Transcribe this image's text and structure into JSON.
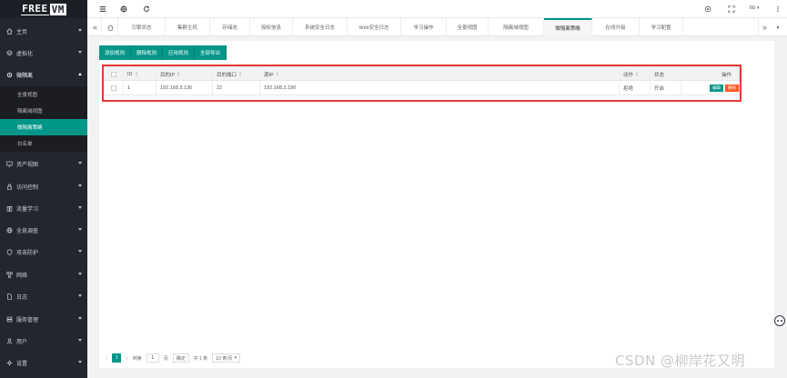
{
  "app": {
    "logo_part1": "FREE",
    "logo_part2": "VM"
  },
  "sidebar": {
    "items": [
      {
        "label": "主页",
        "icon": "home-icon"
      },
      {
        "label": "虚拟化",
        "icon": "layers-icon"
      },
      {
        "label": "微隔离",
        "icon": "gear-icon",
        "open": true
      },
      {
        "label": "资产视图",
        "icon": "monitor-icon"
      },
      {
        "label": "访问控制",
        "icon": "lock-icon"
      },
      {
        "label": "流量学习",
        "icon": "book-icon"
      },
      {
        "label": "全息调查",
        "icon": "globe-icon"
      },
      {
        "label": "攻击防护",
        "icon": "shield-icon"
      },
      {
        "label": "网络",
        "icon": "network-icon"
      },
      {
        "label": "日志",
        "icon": "file-icon"
      },
      {
        "label": "服务管理",
        "icon": "server-icon"
      },
      {
        "label": "用户",
        "icon": "user-icon"
      },
      {
        "label": "设置",
        "icon": "settings-icon"
      }
    ],
    "sub_items": [
      {
        "label": "全景视图",
        "active": false
      },
      {
        "label": "隔离域视图",
        "active": false
      },
      {
        "label": "微隔离策略",
        "active": true
      },
      {
        "label": "白名单",
        "active": false
      }
    ]
  },
  "topbar": {
    "user": "ito"
  },
  "tabs": [
    {
      "label": "引擎状态"
    },
    {
      "label": "集群主机"
    },
    {
      "label": "存储池"
    },
    {
      "label": "授权信息"
    },
    {
      "label": "系统安全日志"
    },
    {
      "label": "Web安全日志"
    },
    {
      "label": "学习操作"
    },
    {
      "label": "全景视图"
    },
    {
      "label": "隔离域视图"
    },
    {
      "label": "微隔离策略",
      "active": true
    },
    {
      "label": "在线升级"
    },
    {
      "label": "学习配置"
    }
  ],
  "toolbar": {
    "add_label": "添加规则",
    "delete_label": "删除规则",
    "apply_label": "应用规则",
    "export_label": "全部导出"
  },
  "table": {
    "columns": [
      "ID",
      "目的IP",
      "目的端口",
      "源IP",
      "动作",
      "状态",
      "操作"
    ],
    "rows": [
      {
        "id": "1",
        "dst_ip": "192.168.3.136",
        "dst_port": "22",
        "src_ip": "192.168.3.190",
        "action": "拒绝",
        "status": "开启",
        "edit_label": "编辑",
        "delete_label": "删除"
      }
    ]
  },
  "pagination": {
    "current_page": "1",
    "goto_prefix": "到第",
    "goto_value": "1",
    "goto_suffix": "页",
    "confirm_label": "确定",
    "total": "共 1 条",
    "page_size": "10 条/页"
  },
  "watermark": "CSDN @柳岸花又明",
  "colors": {
    "accent": "#009688",
    "danger": "#ff5722",
    "highlight": "#e53935",
    "sidebar_bg": "#23262e"
  }
}
